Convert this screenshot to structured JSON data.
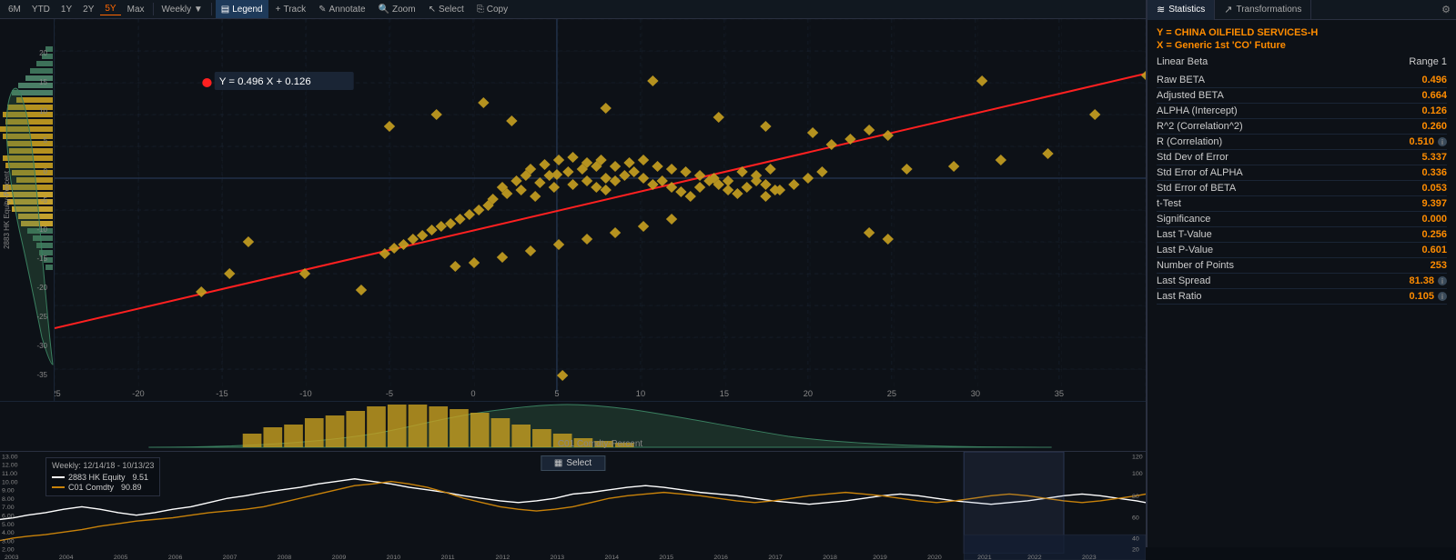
{
  "toolbar": {
    "time_buttons": [
      "6M",
      "YTD",
      "1Y",
      "2Y",
      "5Y",
      "Max"
    ],
    "active_time": "5Y",
    "frequency": "Weekly",
    "tools": [
      "Legend",
      "Track",
      "Annotate",
      "Zoom",
      "Select",
      "Copy"
    ]
  },
  "scatter": {
    "equation": "Y = 0.496 X + 0.126",
    "x_axis_title": "C01 Comdty-Percent",
    "y_axis_title": "2883 HK Equity-Percent",
    "x_labels": [
      "-25",
      "-20",
      "-15",
      "-10",
      "-5",
      "0",
      "5",
      "10",
      "15",
      "20",
      "25",
      "30",
      "35"
    ],
    "y_labels": [
      "20",
      "15",
      "10",
      "5",
      "0",
      "-5",
      "-10",
      "-15",
      "-20",
      "-25",
      "-30",
      "-35"
    ]
  },
  "statistics": {
    "tab_label": "Statistics",
    "transformations_label": "Transformations",
    "y_security": "CHINA OILFIELD SERVICES-H",
    "x_security": "Generic 1st 'CO' Future",
    "y_prefix": "Y =",
    "x_prefix": "X =",
    "title": "Linear Beta",
    "range": "Range 1",
    "rows": [
      {
        "label": "Raw BETA",
        "value": "0.496",
        "has_info": false
      },
      {
        "label": "Adjusted BETA",
        "value": "0.664",
        "has_info": false
      },
      {
        "label": "ALPHA (Intercept)",
        "value": "0.126",
        "has_info": false
      },
      {
        "label": "R^2 (Correlation^2)",
        "value": "0.260",
        "has_info": false
      },
      {
        "label": "R (Correlation)",
        "value": "0.510",
        "has_info": true
      },
      {
        "label": "Std Dev of Error",
        "value": "5.337",
        "has_info": false
      },
      {
        "label": "Std Error of ALPHA",
        "value": "0.336",
        "has_info": false
      },
      {
        "label": "Std Error of BETA",
        "value": "0.053",
        "has_info": false
      },
      {
        "label": "t-Test",
        "value": "9.397",
        "has_info": false
      },
      {
        "label": "Significance",
        "value": "0.000",
        "has_info": false
      },
      {
        "label": "Last T-Value",
        "value": "0.256",
        "has_info": false
      },
      {
        "label": "Last P-Value",
        "value": "0.601",
        "has_info": false
      },
      {
        "label": "Number of Points",
        "value": "253",
        "has_info": false
      },
      {
        "label": "Last Spread",
        "value": "81.38",
        "has_info": true
      },
      {
        "label": "Last Ratio",
        "value": "0.105",
        "has_info": true
      }
    ]
  },
  "timeseries": {
    "date_range": "Weekly: 12/14/18 - 10/13/23",
    "series1_label": "2883 HK Equity",
    "series1_value": "9.51",
    "series2_label": "C01 Comdty",
    "series2_value": "90.89",
    "select_label": "Select",
    "x_labels": [
      "2003",
      "2004",
      "2005",
      "2006",
      "2007",
      "2008",
      "2009",
      "2010",
      "2011",
      "2012",
      "2013",
      "2014",
      "2015",
      "2016",
      "2017",
      "2018",
      "2019",
      "2020",
      "2021",
      "2022",
      "2023"
    ],
    "y_labels_left": [
      "13.00",
      "12.00",
      "11.00",
      "10.00",
      "9.00",
      "8.00",
      "7.00",
      "6.00",
      "5.00",
      "4.00",
      "3.00",
      "2.00"
    ],
    "y_labels_right": [
      "120",
      "100",
      "80",
      "60",
      "40",
      "20"
    ]
  }
}
